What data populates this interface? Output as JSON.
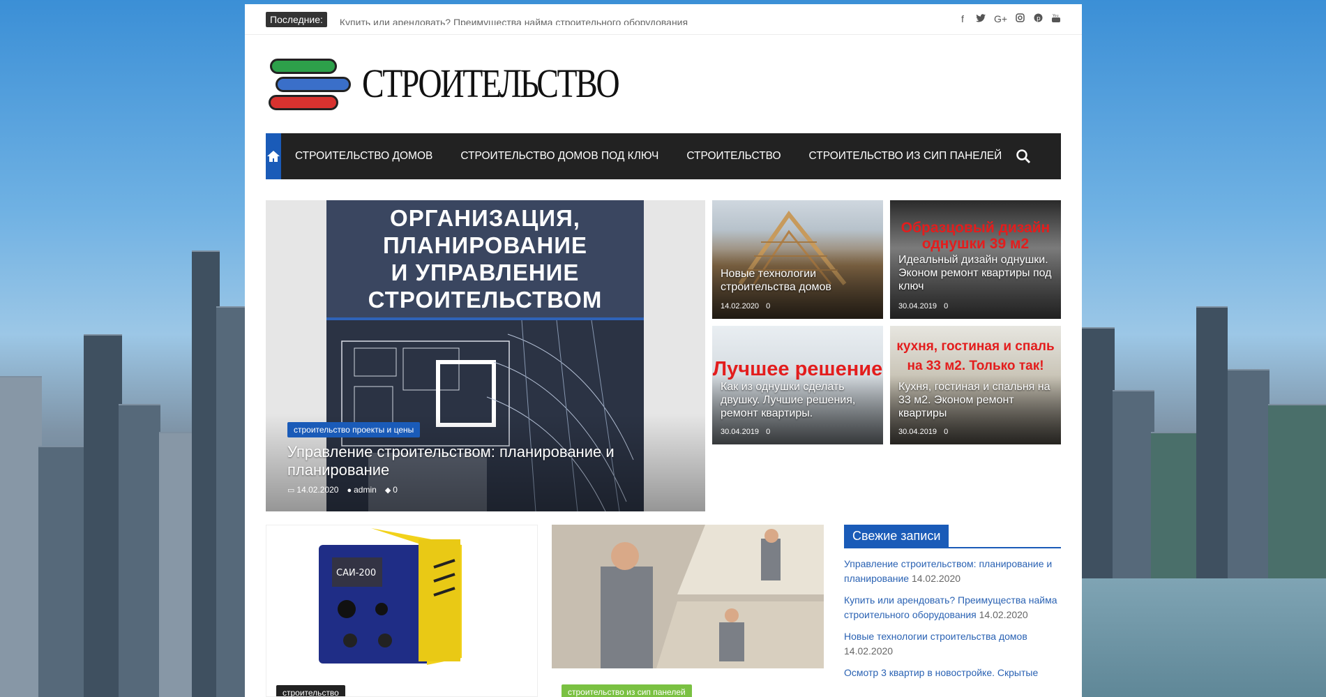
{
  "topbar": {
    "latest_label": "Последние:",
    "latest_text": "Купить или арендовать? Преимущества найма строительного оборудования",
    "social_icons": [
      "facebook-icon",
      "twitter-icon",
      "google-plus-icon",
      "instagram-icon",
      "pinterest-icon",
      "youtube-icon"
    ]
  },
  "header": {
    "logo_text": "СТРОИТЕЛЬСТВО"
  },
  "nav": {
    "items": [
      {
        "label": "СТРОИТЕЛЬСТВО ДОМОВ"
      },
      {
        "label": "СТРОИТЕЛЬСТВО ДОМОВ ПОД КЛЮЧ"
      },
      {
        "label": "СТРОИТЕЛЬСТВО"
      },
      {
        "label": "СТРОИТЕЛЬСТВО ИЗ СИП ПАНЕЛЕЙ"
      }
    ],
    "accent": "#1a5bb8"
  },
  "featured": {
    "cover_lines": [
      "ОРГАНИЗАЦИЯ,",
      "ПЛАНИРОВАНИЕ",
      "И УПРАВЛЕНИЕ",
      "СТРОИТЕЛЬСТВОМ"
    ],
    "category": "строительство проекты и цены",
    "title": "Управление строительством: планирование и планирование",
    "date": "14.02.2020",
    "author": "admin",
    "comments": "0"
  },
  "tiles": [
    {
      "title": "Новые технологии строительства домов",
      "date": "14.02.2020",
      "comments": "0",
      "banner": ""
    },
    {
      "title": "Идеальный дизайн однушки. Эконом ремонт квартиры под ключ",
      "date": "30.04.2019",
      "comments": "0",
      "banner": "Образцовый дизайн однушки 39 м2"
    },
    {
      "title": "Как из однушки сделать двушку. Лучшие решения, ремонт квартиры.",
      "date": "30.04.2019",
      "comments": "0",
      "banner": "Лучшее решение"
    },
    {
      "title": "Кухня, гостиная и спальня на 33 м2. Эконом ремонт квартиры",
      "date": "30.04.2019",
      "comments": "0",
      "banner": "кухня, гостиная и спаль на 33 м2. Только так!"
    }
  ],
  "cards": [
    {
      "category": "строительство",
      "category_color": "#222222",
      "device_label": "САИ-200"
    },
    {
      "category": "строительство из сип панелей",
      "category_color": "#7ac142"
    }
  ],
  "sidebar": {
    "title": "Свежие записи",
    "posts": [
      {
        "title": "Управление строительством: планирование и планирование",
        "date": "14.02.2020"
      },
      {
        "title": "Купить или арендовать? Преимущества найма строительного оборудования",
        "date": "14.02.2020"
      },
      {
        "title": "Новые технологии строительства домов",
        "date": "14.02.2020"
      },
      {
        "title": "Осмотр 3 квартир в новостройке. Скрытые",
        "date": ""
      }
    ]
  }
}
